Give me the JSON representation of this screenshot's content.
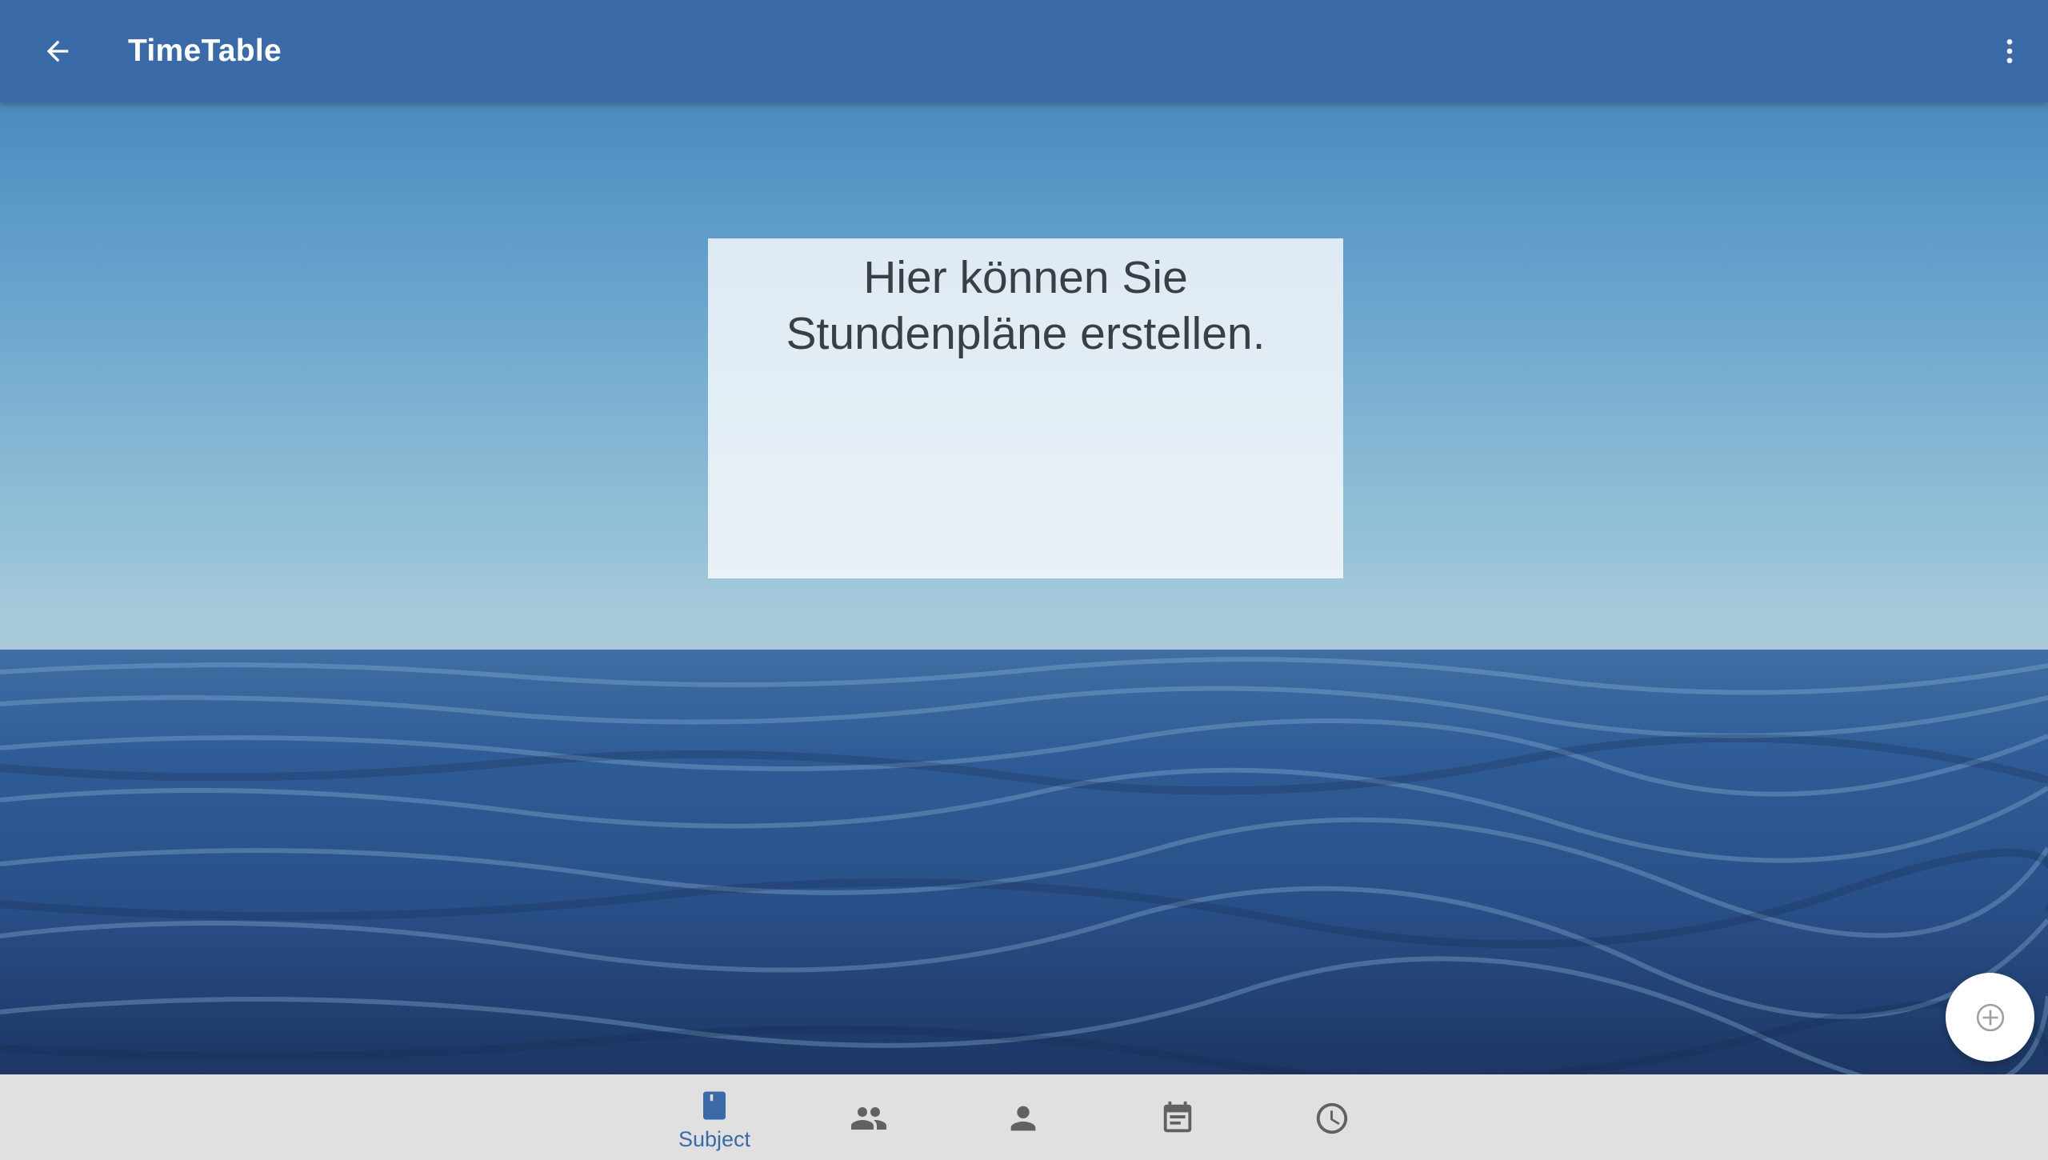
{
  "app_bar": {
    "title": "TimeTable",
    "back_icon": "arrow-back-icon",
    "menu_icon": "more-vert-icon",
    "color": "#3a6aa8"
  },
  "info_card": {
    "text": "Hier können Sie\nStundenpläne erstellen."
  },
  "fab": {
    "icon": "add-circle-icon"
  },
  "bottom_nav": {
    "background": "#e0e0e0",
    "active_color": "#3a6aa8",
    "inactive_color": "#616161",
    "items": [
      {
        "label": "Subject",
        "icon": "book-icon",
        "active": true
      },
      {
        "label": "",
        "icon": "group-icon",
        "active": false
      },
      {
        "label": "",
        "icon": "person-icon",
        "active": false
      },
      {
        "label": "",
        "icon": "calendar-note-icon",
        "active": false
      },
      {
        "label": "",
        "icon": "clock-icon",
        "active": false
      }
    ]
  }
}
